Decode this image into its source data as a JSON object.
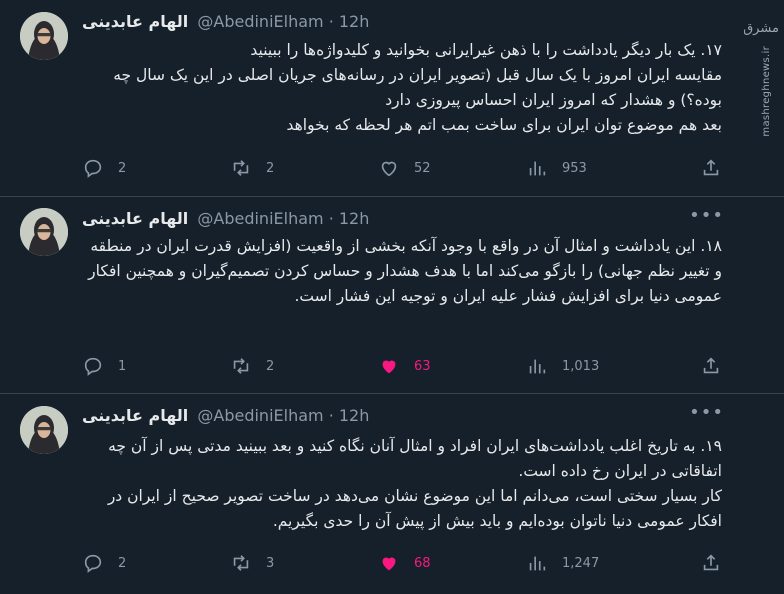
{
  "watermark": {
    "logo_text": "مشرق",
    "site": "mashreghnews.ir"
  },
  "tweets": [
    {
      "name": "الهام عابدینی",
      "handle": "@AbediniElham",
      "time": "12h",
      "text": "۱۷. یک بار دیگر یادداشت را با ذهن غیرایرانی بخوانید و کلیدواژه‌ها را ببینید\nمقایسه ایران امروز با یک سال قبل (تصویر ایران در رسانه‌های جریان اصلی در این یک سال چه بوده؟) و هشدار که امروز ایران احساس پیروزی دارد\nبعد هم موضوع توان ایران برای ساخت بمب اتم هر لحظه که بخواهد",
      "replies": "2",
      "retweets": "2",
      "likes": "52",
      "liked": false,
      "views": "953"
    },
    {
      "name": "الهام عابدینی",
      "handle": "@AbediniElham",
      "time": "12h",
      "text": "۱۸. این یادداشت و امثال آن در واقع با وجود آنکه بخشی از واقعیت (افزایش قدرت ایران در منطقه و تغییر نظم جهانی) را بازگو می‌کند اما با هدف هشدار و حساس کردن تصمیم‌گیران و همچنین افکار عمومی دنیا برای افزایش فشار علیه ایران و توجیه این فشار است.",
      "replies": "1",
      "retweets": "2",
      "likes": "63",
      "liked": true,
      "views": "1,013"
    },
    {
      "name": "الهام عابدینی",
      "handle": "@AbediniElham",
      "time": "12h",
      "text": "۱۹. به تاریخ اغلب یادداشت‌های ایران افراد و امثال آنان نگاه کنید و بعد ببینید مدتی پس از آن چه اتفاقاتی در ایران رخ داده است.\nکار بسیار سختی است، می‌دانم اما این موضوع نشان می‌دهد در ساخت تصویر صحیح از ایران در افکار عمومی دنیا ناتوان بوده‌ایم و باید بیش از پیش آن را حدی بگیریم.",
      "replies": "2",
      "retweets": "3",
      "likes": "68",
      "liked": true,
      "views": "1,247"
    }
  ]
}
